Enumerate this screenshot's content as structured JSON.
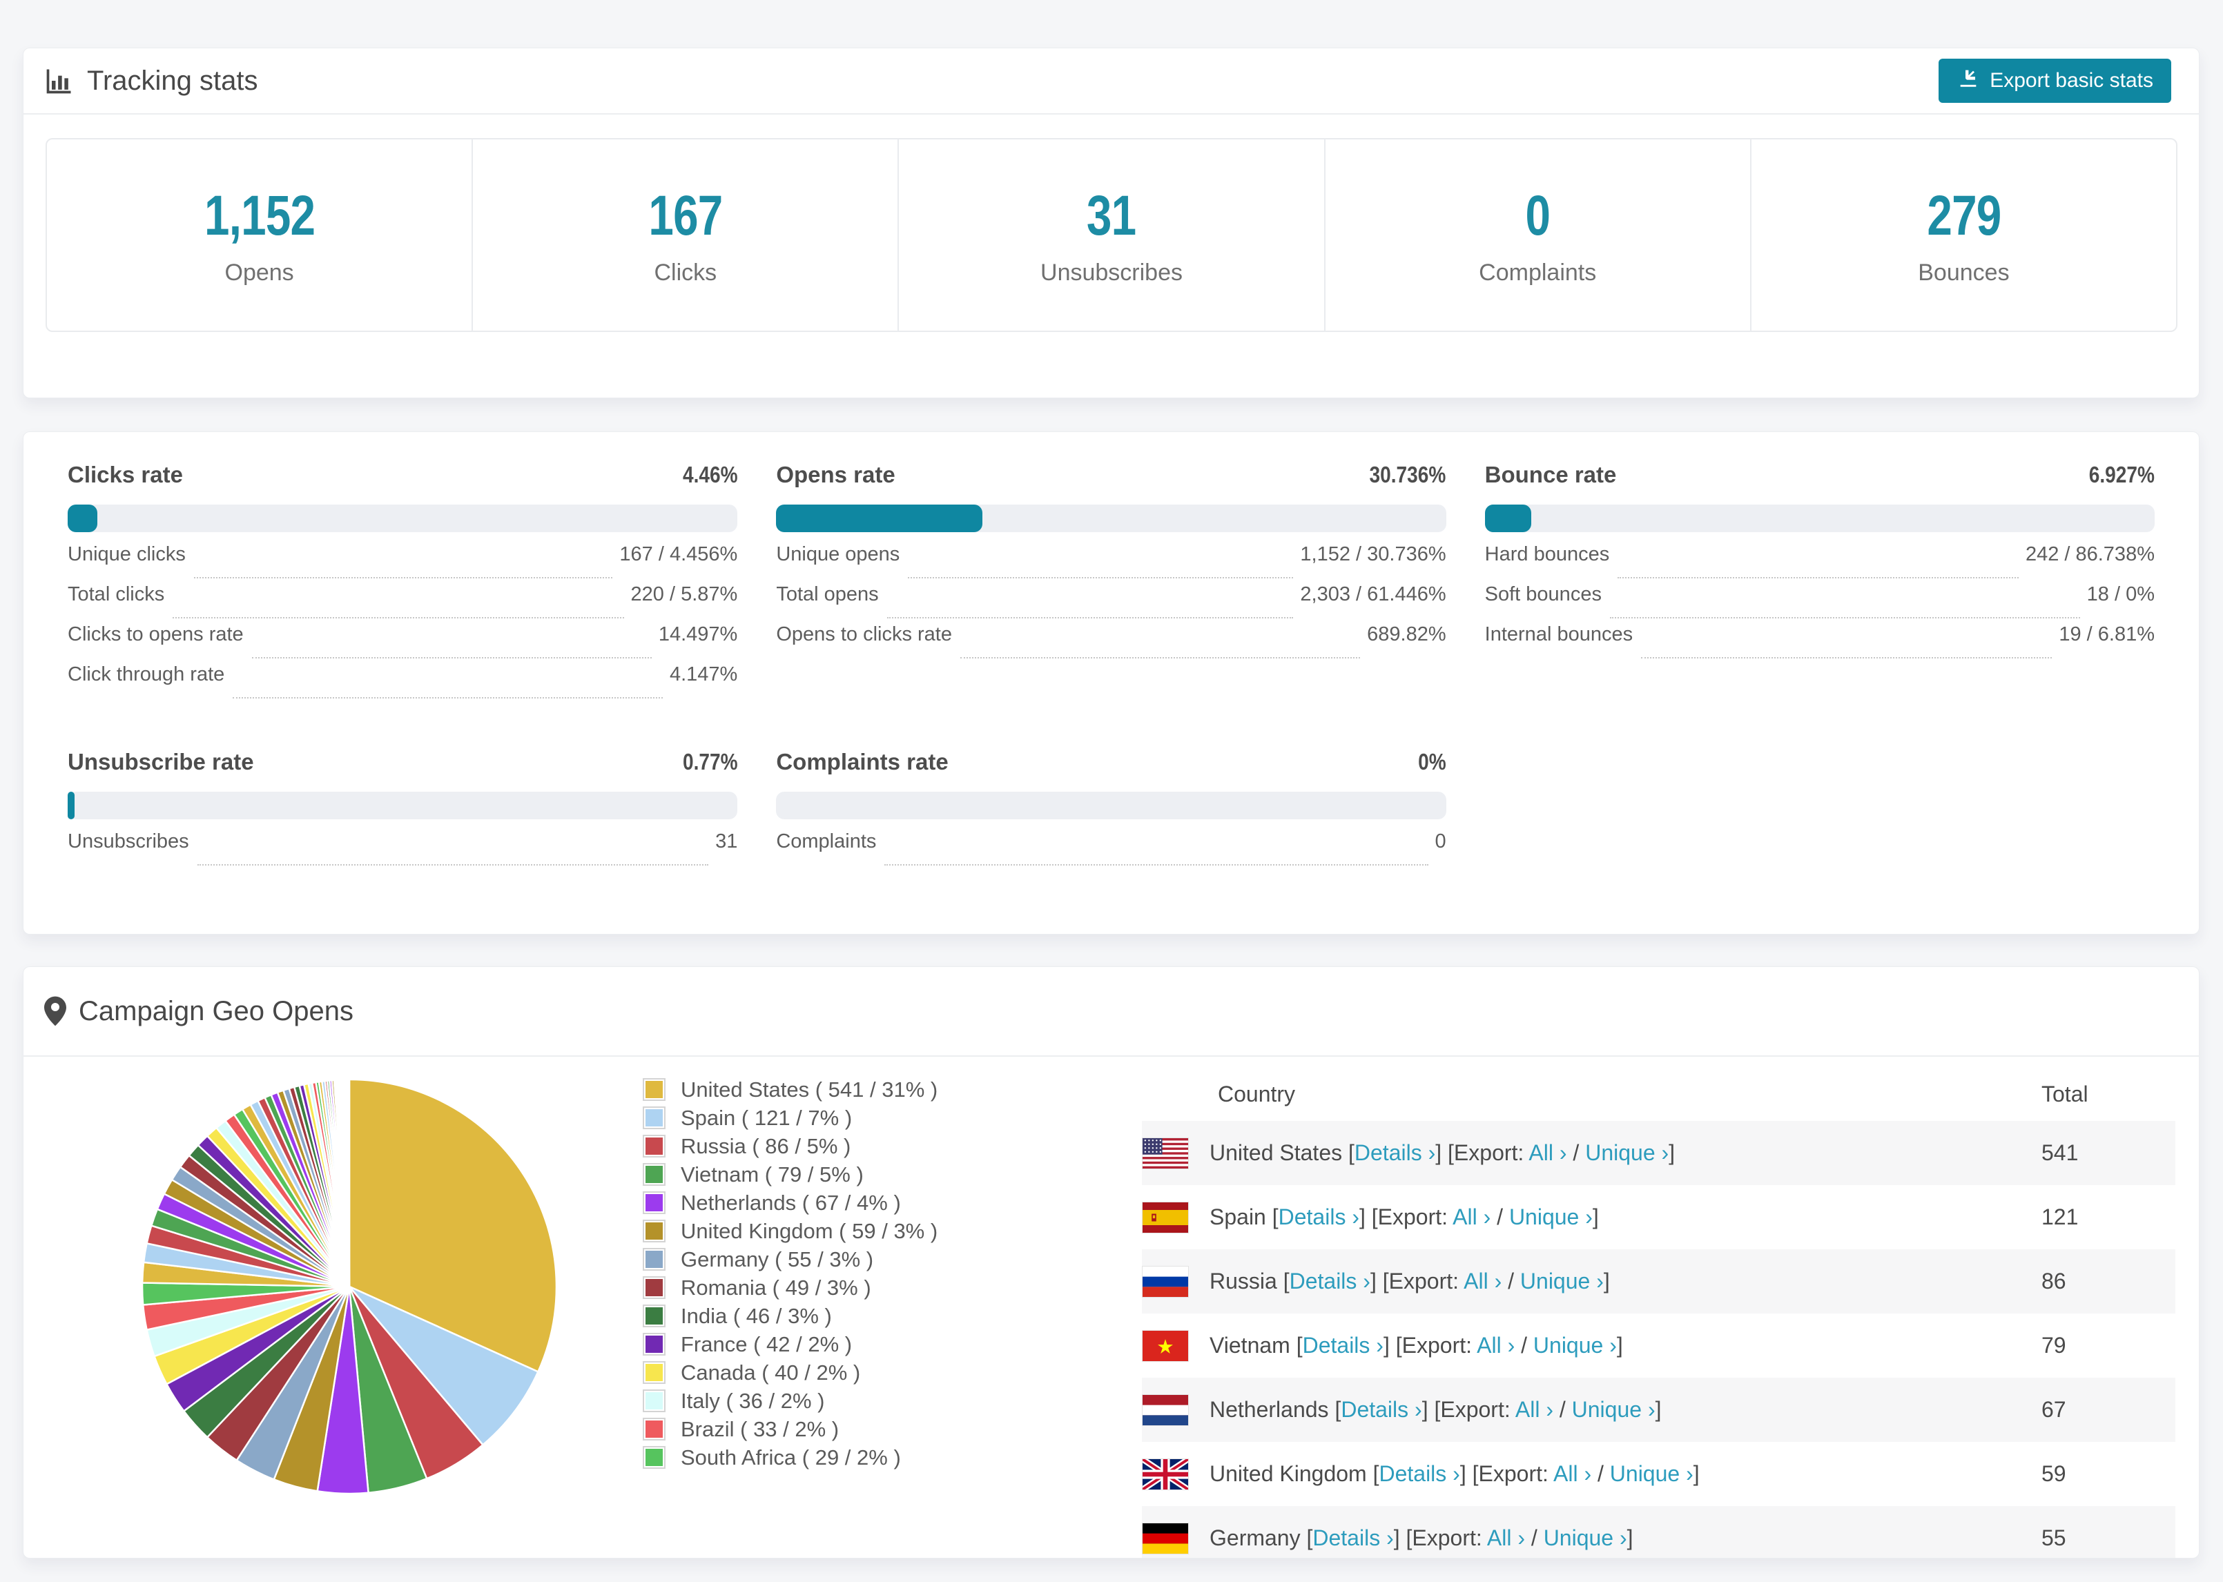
{
  "colors": {
    "accent": "#0f87a1",
    "link": "#2d9cbd",
    "stat_number": "#1d8ca4",
    "bar_track": "#edeff3",
    "page_background": "#f5f6f8"
  },
  "tracking": {
    "title": "Tracking stats",
    "export_button": "Export basic stats",
    "summary": [
      {
        "value": "1,152",
        "label": "Opens"
      },
      {
        "value": "167",
        "label": "Clicks"
      },
      {
        "value": "31",
        "label": "Unsubscribes"
      },
      {
        "value": "0",
        "label": "Complaints"
      },
      {
        "value": "279",
        "label": "Bounces"
      }
    ]
  },
  "rates": [
    {
      "title": "Clicks rate",
      "value": "4.46%",
      "percent": 4.46,
      "rows": [
        {
          "label": "Unique clicks",
          "value": "167 / 4.456%"
        },
        {
          "label": "Total clicks",
          "value": "220 / 5.87%"
        },
        {
          "label": "Clicks to opens rate",
          "value": "14.497%"
        },
        {
          "label": "Click through rate",
          "value": "4.147%"
        }
      ]
    },
    {
      "title": "Opens rate",
      "value": "30.736%",
      "percent": 30.736,
      "rows": [
        {
          "label": "Unique opens",
          "value": "1,152 / 30.736%"
        },
        {
          "label": "Total opens",
          "value": "2,303 / 61.446%"
        },
        {
          "label": "Opens to clicks rate",
          "value": "689.82%"
        }
      ]
    },
    {
      "title": "Bounce rate",
      "value": "6.927%",
      "percent": 6.927,
      "rows": [
        {
          "label": "Hard bounces",
          "value": "242 / 86.738%"
        },
        {
          "label": "Soft bounces",
          "value": "18 / 0%"
        },
        {
          "label": "Internal bounces",
          "value": "19 / 6.81%"
        }
      ]
    },
    {
      "title": "Unsubscribe rate",
      "value": "0.77%",
      "percent": 0.77,
      "rows": [
        {
          "label": "Unsubscribes",
          "value": "31"
        }
      ]
    },
    {
      "title": "Complaints rate",
      "value": "0%",
      "percent": 0,
      "rows": [
        {
          "label": "Complaints",
          "value": "0"
        }
      ]
    }
  ],
  "geo": {
    "title": "Campaign Geo Opens",
    "table": {
      "columns": [
        "Country",
        "Total"
      ],
      "details_label": "Details ›",
      "all_label": "All ›",
      "unique_label": "Unique ›",
      "export_prefix": "[Export:",
      "open_bracket": "[",
      "close_bracket": "]",
      "slash": "/",
      "rows": [
        {
          "country": "United States",
          "flag": "us",
          "total": "541"
        },
        {
          "country": "Spain",
          "flag": "es",
          "total": "121"
        },
        {
          "country": "Russia",
          "flag": "ru",
          "total": "86"
        },
        {
          "country": "Vietnam",
          "flag": "vn",
          "total": "79"
        },
        {
          "country": "Netherlands",
          "flag": "nl",
          "total": "67"
        },
        {
          "country": "United Kingdom",
          "flag": "gb",
          "total": "59"
        },
        {
          "country": "Germany",
          "flag": "de",
          "total": "55",
          "clipped": true
        }
      ]
    }
  },
  "chart_data": {
    "type": "pie",
    "title": "Campaign Geo Opens",
    "legend_position": "right",
    "start_angle_deg": 0,
    "direction": "clockwise",
    "labels": [
      "United States",
      "Spain",
      "Russia",
      "Vietnam",
      "Netherlands",
      "United Kingdom",
      "Germany",
      "Romania",
      "India",
      "France",
      "Canada",
      "Italy",
      "Brazil",
      "South Africa"
    ],
    "values": [
      541,
      121,
      86,
      79,
      67,
      59,
      55,
      49,
      46,
      42,
      40,
      36,
      33,
      29
    ],
    "percent_labels": [
      "31%",
      "7%",
      "5%",
      "5%",
      "4%",
      "3%",
      "3%",
      "3%",
      "3%",
      "2%",
      "2%",
      "2%",
      "2%",
      "2%"
    ],
    "colors": [
      "#dfb93f",
      "#aed3f2",
      "#c8494e",
      "#4ea553",
      "#9c3bee",
      "#b4922a",
      "#8aa8c8",
      "#a03b40",
      "#3b7d42",
      "#7129b3",
      "#f7e64e",
      "#d8fcfa",
      "#ef5a5e",
      "#56c45e"
    ],
    "other_slices_estimated": [
      27,
      25,
      24,
      23,
      22,
      21,
      20,
      19,
      18,
      17,
      16,
      15,
      14,
      13,
      12,
      11,
      10,
      9,
      9,
      8,
      8,
      7,
      7,
      6,
      6,
      5,
      5,
      4,
      4,
      4,
      3,
      3,
      3,
      3,
      2,
      2,
      2,
      2,
      2,
      2,
      1,
      1,
      1,
      1,
      1,
      1,
      1,
      1
    ],
    "legend_format": "{label} ( {value} / {pct} )"
  }
}
